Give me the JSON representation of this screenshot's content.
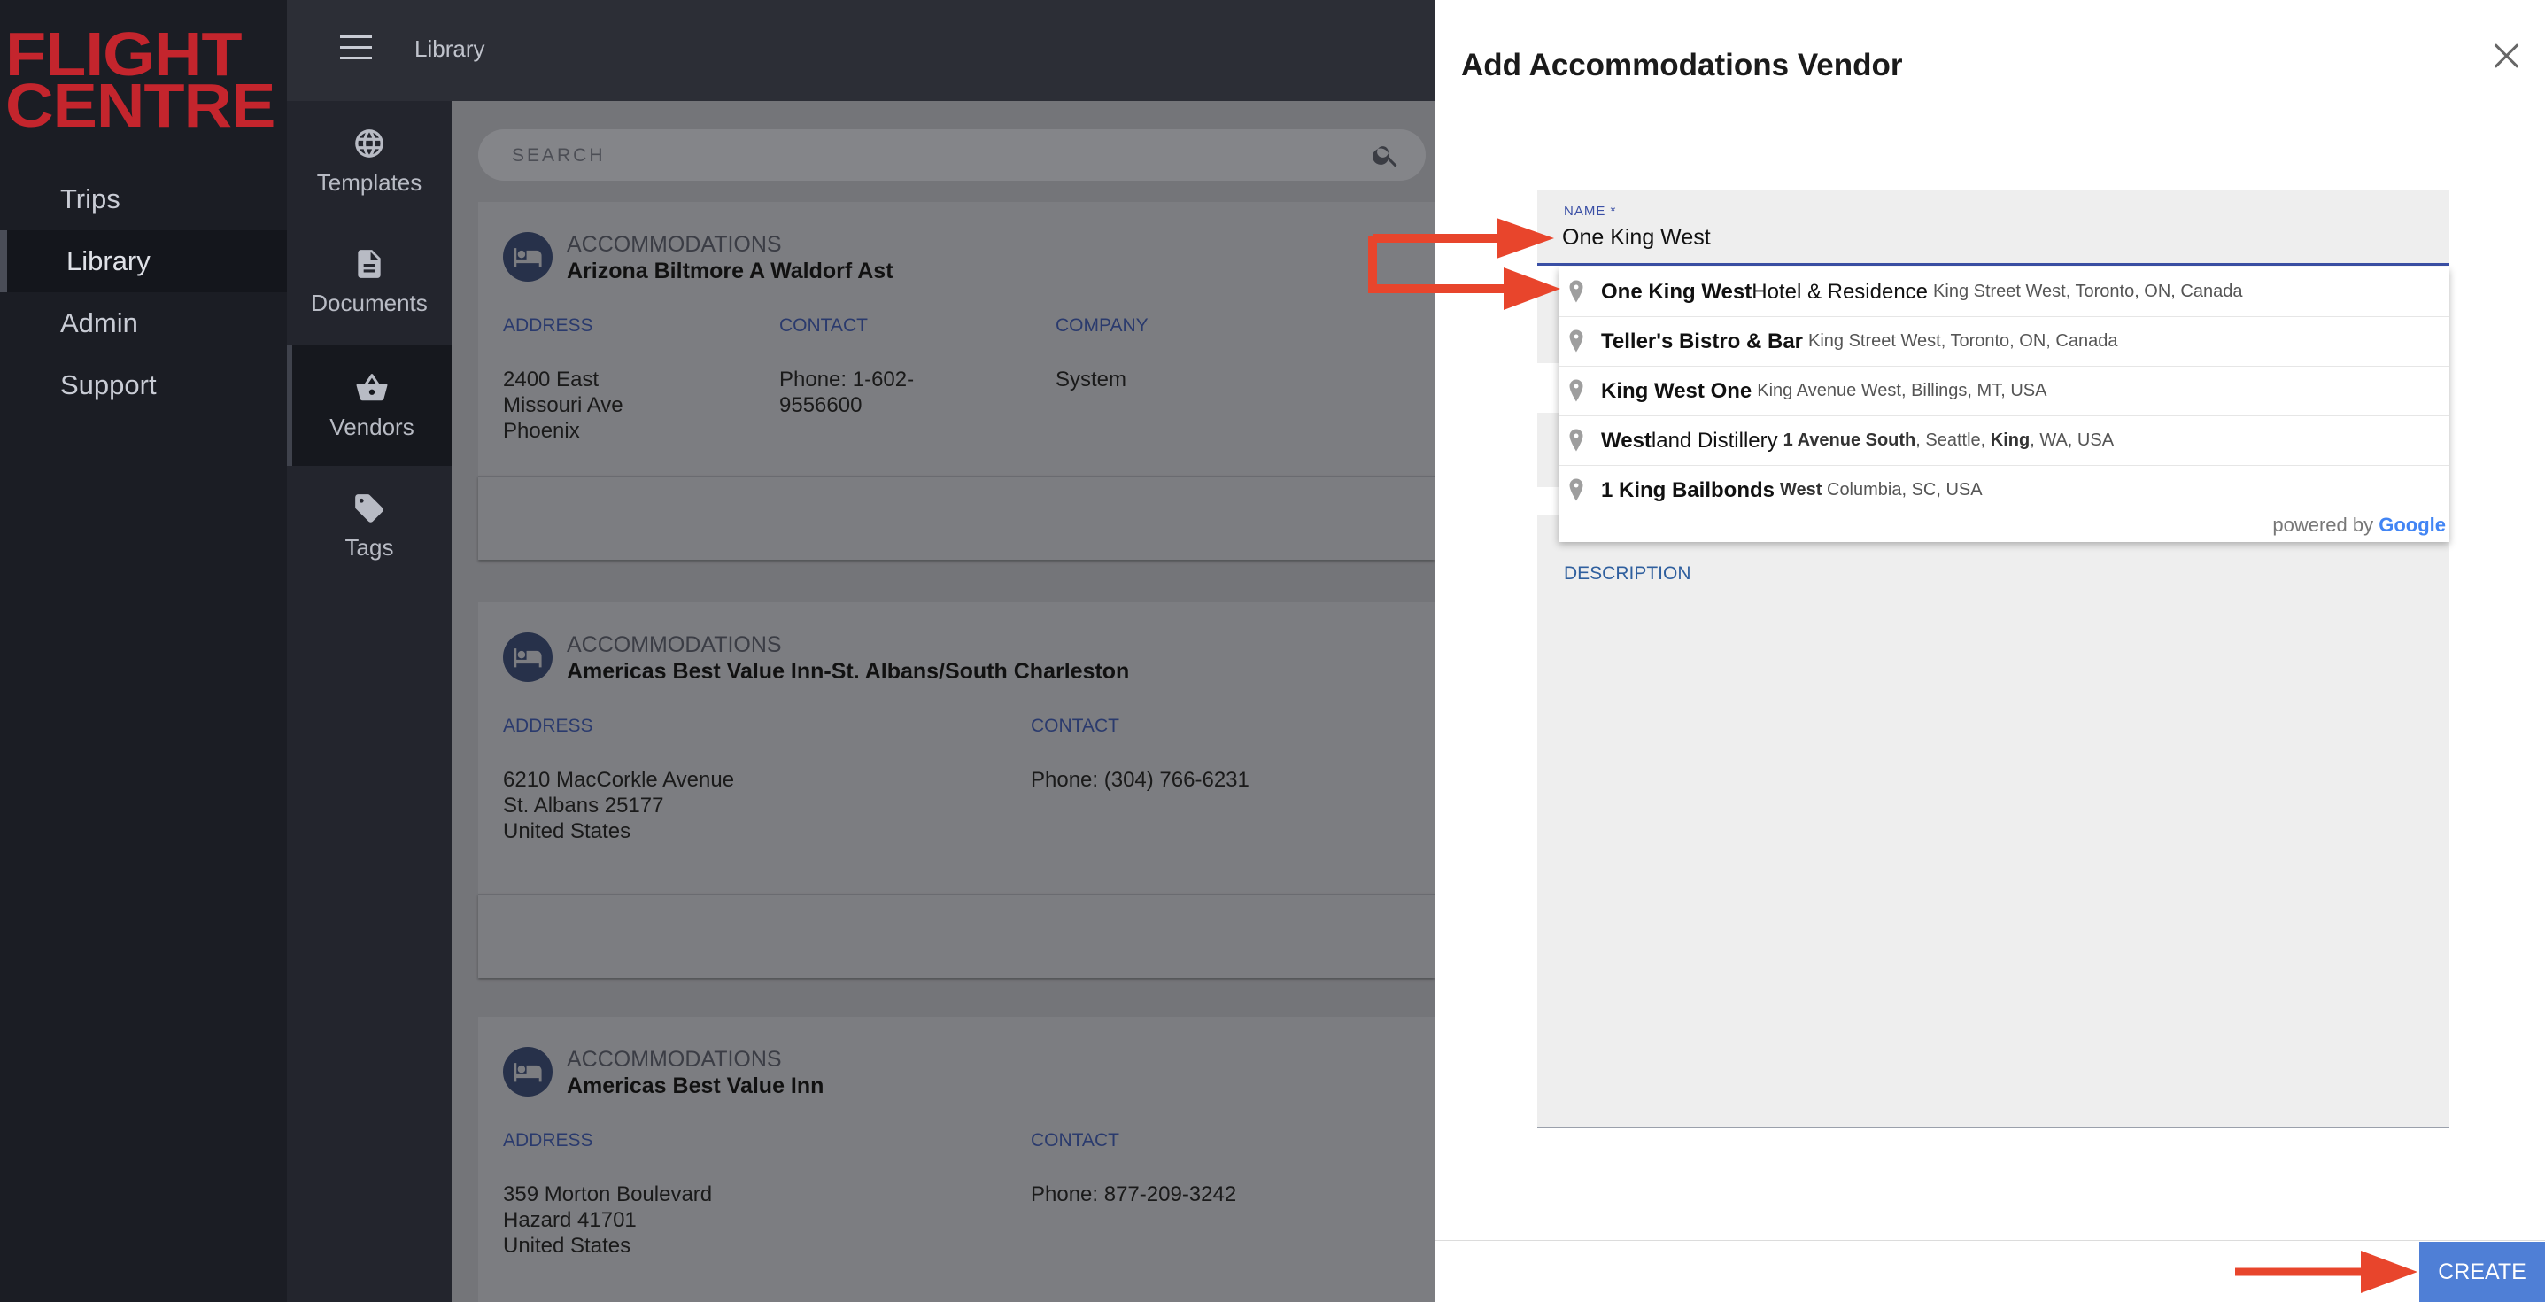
{
  "brand": {
    "line1": "FLIGHT",
    "line2": "CENTRE",
    "mark": "™"
  },
  "nav": [
    {
      "label": "Trips",
      "active": false
    },
    {
      "label": "Library",
      "active": true
    },
    {
      "label": "Admin",
      "active": false
    },
    {
      "label": "Support",
      "active": false
    }
  ],
  "rail": [
    {
      "label": "Templates",
      "icon": "globe-icon",
      "active": false
    },
    {
      "label": "Documents",
      "icon": "document-icon",
      "active": false
    },
    {
      "label": "Vendors",
      "icon": "basket-icon",
      "active": true
    },
    {
      "label": "Tags",
      "icon": "tag-icon",
      "active": false
    }
  ],
  "topbar": {
    "title": "Library"
  },
  "search": {
    "placeholder": "SEARCH"
  },
  "cards": [
    {
      "category": "ACCOMMODATIONS",
      "name": "Arizona Biltmore A Waldorf Ast",
      "address_label": "ADDRESS",
      "address": "2400 East\nMissouri Ave\nPhoenix",
      "contact_label": "CONTACT",
      "contact": "Phone: 1-602-\n9556600",
      "company_label": "COMPANY",
      "company": "System"
    },
    {
      "category": "ACCOMMODATIONS",
      "name": "Americas Best Value Inn-St. Albans/South Charleston",
      "address_label": "ADDRESS",
      "address": "6210 MacCorkle Avenue\nSt. Albans 25177\nUnited States",
      "contact_label": "CONTACT",
      "contact": "Phone: (304) 766-6231"
    },
    {
      "category": "ACCOMMODATIONS",
      "name": "Americas Best Value Inn",
      "address_label": "ADDRESS",
      "address": "359 Morton Boulevard\nHazard 41701\nUnited States",
      "contact_label": "CONTACT",
      "contact": "Phone: 877-209-3242"
    }
  ],
  "modal": {
    "title": "Add Accommodations Vendor",
    "name_label": "NAME *",
    "name_value": "One King West",
    "description_label": "DESCRIPTION",
    "create_label": "CREATE"
  },
  "suggestions": [
    {
      "bold": "One King West",
      "rest": " Hotel & Residence",
      "sub": "King Street West, Toronto, ON, Canada"
    },
    {
      "bold": "Teller's Bistro & Bar",
      "rest": "",
      "sub": "King Street West, Toronto, ON, Canada"
    },
    {
      "bold": "King West One",
      "rest": "",
      "sub": "King Avenue West, Billings, MT, USA"
    },
    {
      "bold": "West",
      "rest": "land Distillery",
      "sub_bold1": "1 Avenue South",
      "sub_mid": ", Seattle, ",
      "sub_bold2": "King",
      "sub_end": ", WA, USA"
    },
    {
      "bold": "1 King Bailbonds",
      "rest": "",
      "sub_bold1": "West",
      "sub_end": " Columbia, SC, USA"
    }
  ],
  "powered_by": {
    "prefix": "powered by ",
    "brand": "Google"
  },
  "colors": {
    "accent": "#4f7fd6",
    "arrow": "#e8452c",
    "brand_red": "#c4252d"
  }
}
